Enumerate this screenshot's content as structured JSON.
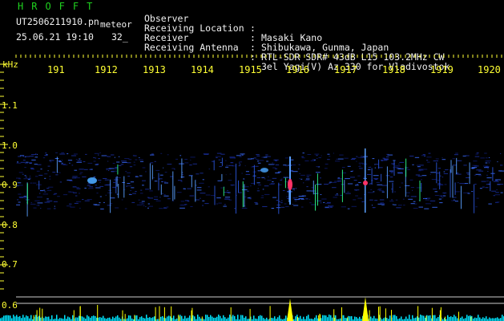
{
  "header": {
    "title": "HROFFT",
    "filename": "UT2506211910.pn",
    "subtitle": "meteor",
    "date_time": "25.06.21 19:10",
    "number": "32_"
  },
  "info": [
    {
      "label": "Observer",
      "value": "Masaki Kano"
    },
    {
      "label": "Receiving Location",
      "value": "Shibukawa, Gunma, Japan"
    },
    {
      "label": "Receiver",
      "value": "RTL-SDR SDR# 43dB L15 103.2MHz CW"
    },
    {
      "label": "Receiving Antenna",
      "value": "3el Yagi(V) Az 330 for Vladivostok"
    }
  ],
  "colon": ":",
  "axis": {
    "unit_label": "kHz",
    "x_ticks": [
      "191",
      "1912",
      "1913",
      "1914",
      "1915",
      "1916",
      "1917",
      "1918",
      "1919",
      "1920"
    ],
    "y_ticks": [
      "1.1",
      "1.0",
      "0.9",
      "0.8",
      "0.7",
      "0.6"
    ]
  },
  "colors": {
    "title": "#1fd11f",
    "info_text": "#f0f0f0",
    "ticks": "#ffff33",
    "spectrum_band": "#1a3fd6",
    "meteor_echo": "#ff3366",
    "histogram": "#ffff00",
    "histogram_noise": "#00e5ff"
  }
}
